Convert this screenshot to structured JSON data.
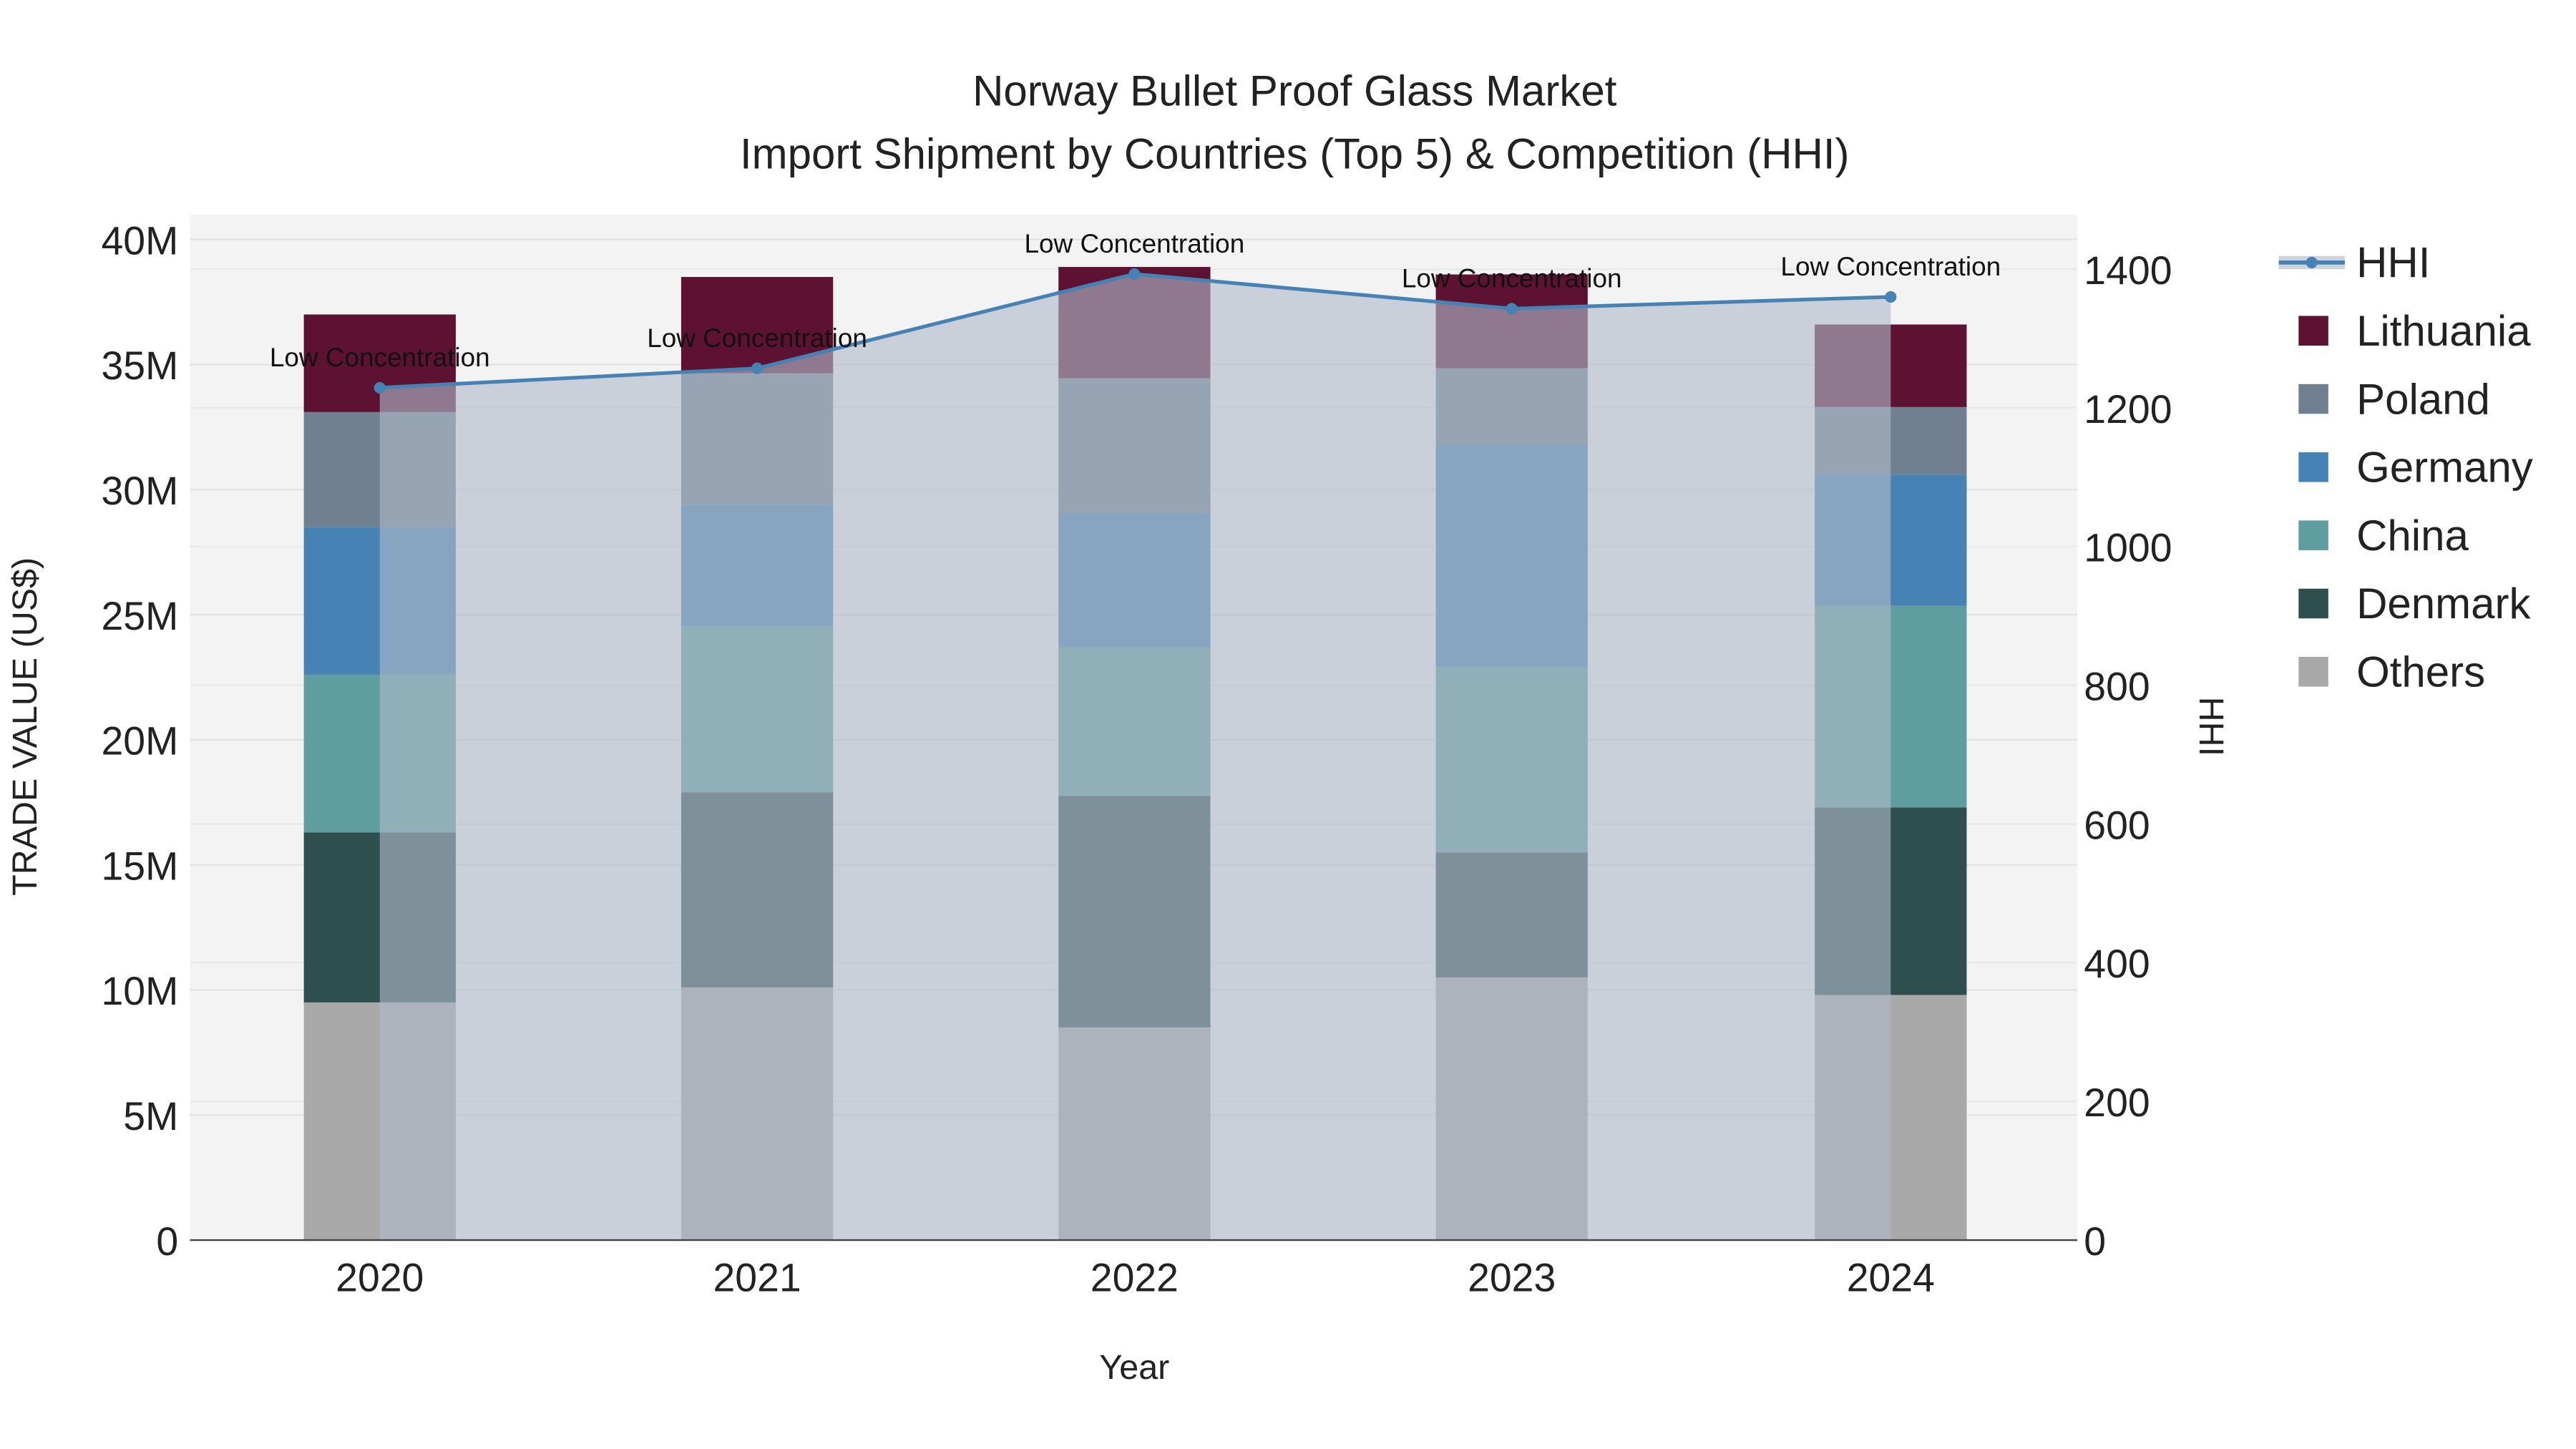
{
  "chart_data": {
    "type": "bar",
    "stacked": true,
    "title": "Norway Bullet Proof Glass Market",
    "subtitle": "Import Shipment by Countries (Top 5) & Competition (HHI)",
    "xlabel": "Year",
    "ylabel": "TRADE VALUE (US$)",
    "y2label": "HHI",
    "categories": [
      "2020",
      "2021",
      "2022",
      "2023",
      "2024"
    ],
    "ylim": [
      0,
      41000000
    ],
    "y2lim": [
      0,
      1480
    ],
    "yticks": [
      0,
      5000000,
      10000000,
      15000000,
      20000000,
      25000000,
      30000000,
      35000000,
      40000000
    ],
    "ytick_labels": [
      "0",
      "5M",
      "10M",
      "15M",
      "20M",
      "25M",
      "30M",
      "35M",
      "40M"
    ],
    "y2ticks": [
      0,
      200,
      400,
      600,
      800,
      1000,
      1200,
      1400
    ],
    "y2tick_labels": [
      "0",
      "200",
      "400",
      "600",
      "800",
      "1000",
      "1200",
      "1400"
    ],
    "series": [
      {
        "name": "Others",
        "color": "#a9a9a9",
        "values": [
          9500000,
          10100000,
          8500000,
          10500000,
          9800000
        ]
      },
      {
        "name": "Denmark",
        "color": "#2f4f4f",
        "values": [
          6800000,
          7800000,
          9250000,
          5000000,
          7500000
        ]
      },
      {
        "name": "China",
        "color": "#5f9ea0",
        "values": [
          6300000,
          6650000,
          5950000,
          7400000,
          8050000
        ]
      },
      {
        "name": "Germany",
        "color": "#4682b4",
        "values": [
          5900000,
          4850000,
          5350000,
          8900000,
          5250000
        ]
      },
      {
        "name": "Poland",
        "color": "#708090",
        "values": [
          4600000,
          5250000,
          5400000,
          3050000,
          2700000
        ]
      },
      {
        "name": "Lithuania",
        "color": "#5e1232",
        "values": [
          3900000,
          3850000,
          4450000,
          3750000,
          3300000
        ]
      }
    ],
    "hhi": {
      "name": "HHI",
      "color": "#4682b4",
      "values": [
        1229,
        1257,
        1393,
        1343,
        1360
      ],
      "annotations": [
        "Low Concentration",
        "Low Concentration",
        "Low Concentration",
        "Low Concentration",
        "Low Concentration"
      ]
    },
    "legend_order": [
      "HHI",
      "Lithuania",
      "Poland",
      "Germany",
      "China",
      "Denmark",
      "Others"
    ],
    "legend_position": "right",
    "grid": true
  }
}
